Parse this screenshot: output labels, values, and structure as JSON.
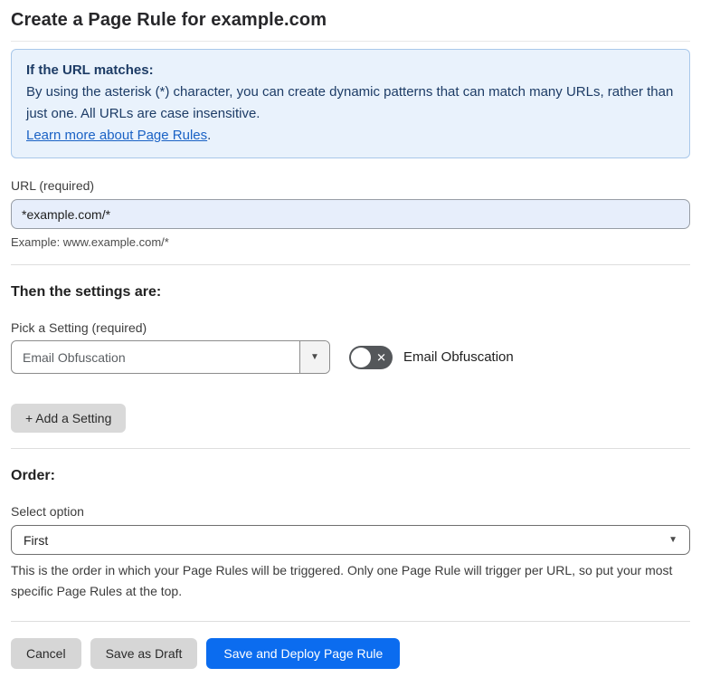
{
  "page": {
    "title": "Create a Page Rule for example.com"
  },
  "info_box": {
    "heading": "If the URL matches:",
    "body": "By using the asterisk (*) character, you can create dynamic patterns that can match many URLs, rather than just one. All URLs are case insensitive.",
    "link_label": "Learn more about Page Rules",
    "link_suffix": "."
  },
  "url_field": {
    "label": "URL (required)",
    "value": "*example.com/*",
    "hint": "Example: www.example.com/*"
  },
  "settings_section": {
    "heading": "Then the settings are:",
    "picker_label": "Pick a Setting (required)",
    "picker_value": "Email Obfuscation",
    "toggle_label": "Email Obfuscation",
    "toggle_state": "off",
    "add_button_label": "+ Add a Setting"
  },
  "order_section": {
    "heading": "Order:",
    "select_label": "Select option",
    "select_value": "First",
    "hint": "This is the order in which your Page Rules will be triggered. Only one Page Rule will trigger per URL, so put your most specific Page Rules at the top."
  },
  "footer": {
    "cancel_label": "Cancel",
    "save_draft_label": "Save as Draft",
    "save_deploy_label": "Save and Deploy Page Rule"
  },
  "icons": {
    "dropdown_arrow": "▼",
    "toggle_off_x": "✕"
  },
  "colors": {
    "info_box_bg": "#e9f2fc",
    "info_box_border": "#a9c8ea",
    "info_text": "#1d3c66",
    "link_blue": "#1a62c5",
    "url_input_bg": "#e7eefb",
    "toggle_off_bg": "#54575a",
    "gray_button_bg": "#d6d6d6",
    "primary_button_bg": "#0b6cef"
  }
}
